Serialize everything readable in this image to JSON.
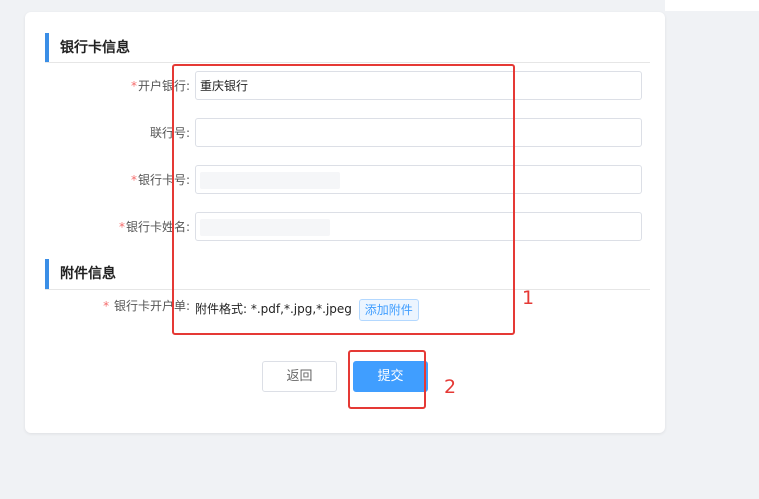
{
  "bank_section": {
    "title": "银行卡信息",
    "fields": [
      {
        "label": "开户银行:",
        "required": true,
        "value": "重庆银行",
        "redacted": false
      },
      {
        "label": "联行号:",
        "required": false,
        "value": "",
        "redacted": false
      },
      {
        "label": "银行卡号:",
        "required": true,
        "value": "",
        "redacted": true
      },
      {
        "label": "银行卡姓名:",
        "required": true,
        "value": "",
        "redacted": true
      }
    ]
  },
  "attachment_section": {
    "title": "附件信息",
    "label": "银行卡开户单:",
    "required": true,
    "format_text": "附件格式: *.pdf,*.jpg,*.jpeg",
    "add_button": "添加附件"
  },
  "actions": {
    "back_label": "返回",
    "submit_label": "提交"
  },
  "annotations": {
    "marker_1": "1",
    "marker_2": "2",
    "color": "#e53935"
  },
  "colors": {
    "accent": "#409eff",
    "required": "#f56c6c",
    "section_bar": "#3a8ee6"
  }
}
